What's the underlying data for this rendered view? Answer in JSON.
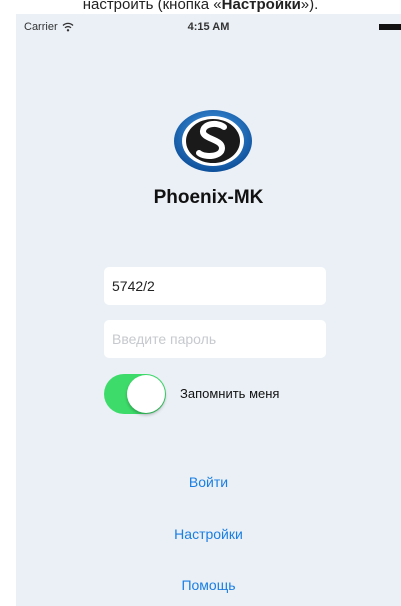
{
  "caption": {
    "prefix": "настроить (кнопка «",
    "bold": "Настройки",
    "suffix": "»)."
  },
  "status_bar": {
    "carrier": "Carrier",
    "time": "4:15 AM",
    "icons": [
      "wifi-icon",
      "battery-icon"
    ]
  },
  "app": {
    "logo_icon": "phoenix-logo-icon",
    "title": "Phoenix-MK"
  },
  "form": {
    "login_value": "5742/2",
    "password_placeholder": "Введите пароль",
    "remember_label": "Запомнить меня",
    "remember_on": true
  },
  "actions": {
    "login": "Войти",
    "settings": "Настройки",
    "help": "Помощь"
  },
  "colors": {
    "background": "#eaf0f6",
    "toggle_on": "#3ddc6a",
    "link": "#1a7fe3",
    "logo_ring": "#1565b8"
  }
}
